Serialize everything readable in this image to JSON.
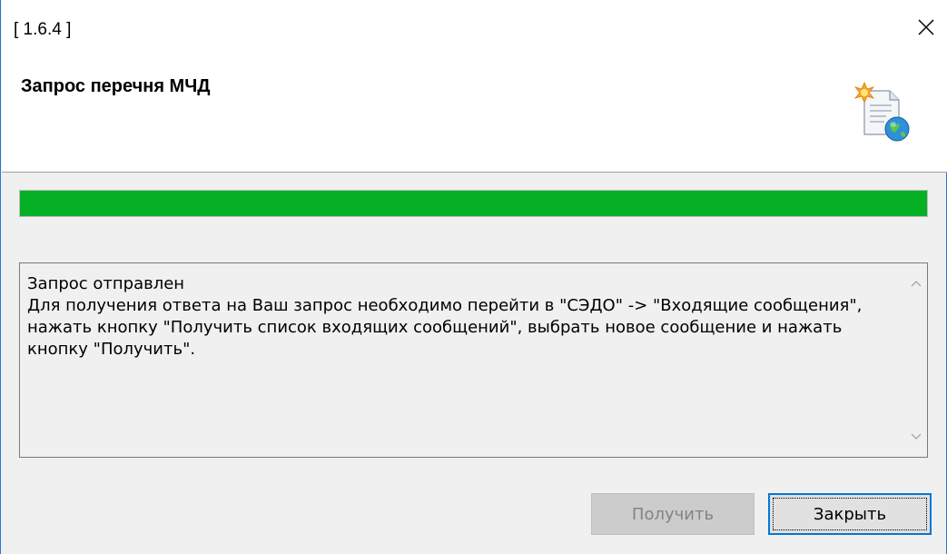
{
  "window": {
    "title": "[ 1.6.4 ]",
    "close_glyph": "✕"
  },
  "header": {
    "title": "Запрос перечня МЧД",
    "icon": "document-globe-icon"
  },
  "progress": {
    "value_percent": 100,
    "color": "#06b025"
  },
  "message": {
    "text": "Запрос отправлен\nДля получения ответа на Ваш запрос необходимо перейти в \"СЭДО\" -> \"Входящие сообщения\", нажать кнопку \"Получить список входящих сообщений\", выбрать новое сообщение и нажать кнопку \"Получить\"."
  },
  "buttons": {
    "get_label": "Получить",
    "get_enabled": false,
    "close_label": "Закрыть"
  },
  "colors": {
    "accent": "#0078d7",
    "window_border": "#2b78c8"
  }
}
